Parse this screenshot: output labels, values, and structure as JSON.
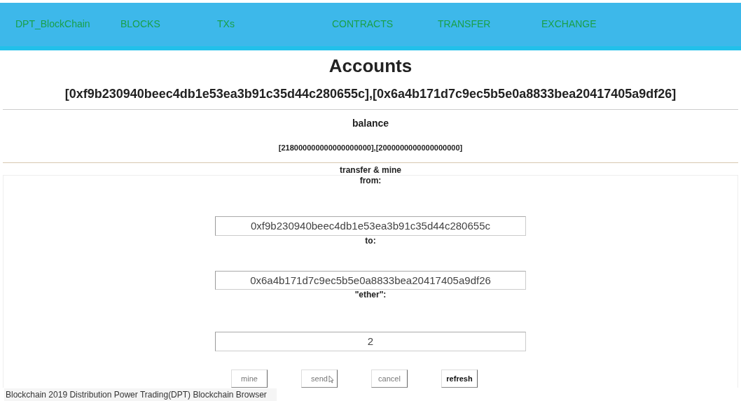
{
  "nav": {
    "brand": "DPT_BlockChain",
    "items": [
      "BLOCKS",
      "TXs",
      "CONTRACTS",
      "TRANSFER",
      "EXCHANGE"
    ]
  },
  "title": "Accounts",
  "accounts": "[0xf9b230940beec4db1e53ea3b91c35d44c280655c],[0x6a4b171d7c9ec5b5e0a8833bea20417405a9df26]",
  "balance": {
    "label": "balance",
    "value": "[218000000000000000000],[2000000000000000000]"
  },
  "form": {
    "title": "transfer & mine",
    "rows": [
      {
        "kind": "label",
        "text": "from:"
      },
      {
        "kind": "input",
        "value": "0xf9b230940beec4db1e53ea3b91c35d44c280655c"
      },
      {
        "kind": "label",
        "text": "to:"
      },
      {
        "kind": "input",
        "value": "0x6a4b171d7c9ec5b5e0a8833bea20417405a9df26"
      },
      {
        "kind": "label",
        "text": "\"ether\":"
      },
      {
        "kind": "input",
        "value": "2"
      }
    ],
    "buttons": [
      {
        "label": "mine",
        "disabled": true
      },
      {
        "label": "send",
        "disabled": true
      },
      {
        "label": "cancel",
        "disabled": true
      },
      {
        "label": "refresh",
        "disabled": false
      }
    ]
  },
  "footer": "Blockchain 2019 Distribution Power Trading(DPT) Blockchain Browser"
}
